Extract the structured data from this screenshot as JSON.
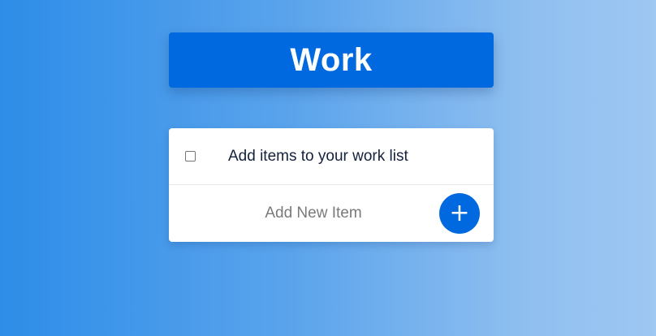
{
  "header": {
    "title": "Work"
  },
  "list": {
    "items": [
      {
        "label": "Add items to your work list",
        "checked": false
      }
    ]
  },
  "new_item": {
    "placeholder": "Add New Item",
    "value": "",
    "add_button_label": "+",
    "add_button_icon": "plus-icon"
  },
  "colors": {
    "accent": "#0069e0",
    "card_bg": "#ffffff",
    "text": "#14213d"
  }
}
